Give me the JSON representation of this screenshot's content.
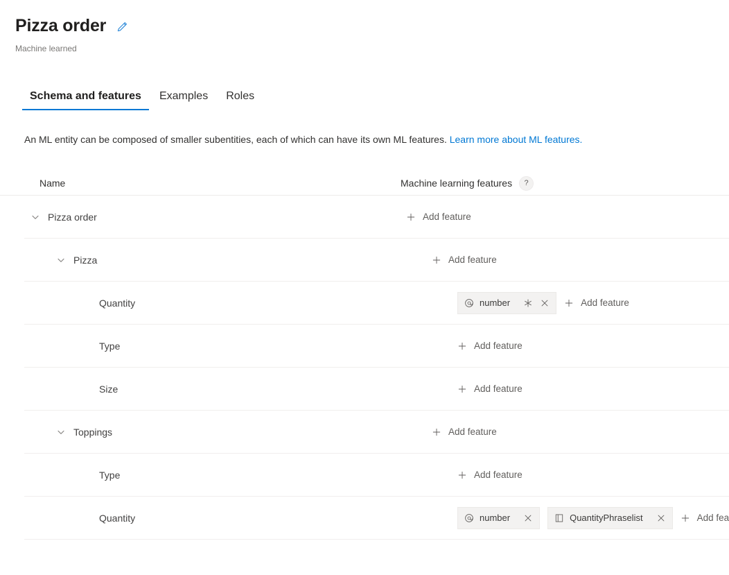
{
  "header": {
    "title": "Pizza order",
    "edit_icon": "pencil-icon",
    "subtitle": "Machine learned",
    "accent_color": "#0078d4"
  },
  "tabs": [
    {
      "label": "Schema and features",
      "active": true
    },
    {
      "label": "Examples",
      "active": false
    },
    {
      "label": "Roles",
      "active": false
    }
  ],
  "description": {
    "text": "An ML entity can be composed of smaller subentities, each of which can have its own ML features.",
    "link_text": "Learn more about ML features."
  },
  "table": {
    "columns": {
      "name": "Name",
      "features": "Machine learning features",
      "help_badge": "?"
    },
    "add_feature_label": "Add feature",
    "rows": [
      {
        "name": "Pizza order",
        "depth": 0,
        "expandable": true,
        "chevron": "chevron-down-icon",
        "chips": []
      },
      {
        "name": "Pizza",
        "depth": 1,
        "expandable": true,
        "chevron": "chevron-down-icon",
        "chips": []
      },
      {
        "name": "Quantity",
        "depth": 2,
        "expandable": false,
        "chips": [
          {
            "icon": "at-sign-icon",
            "label": "number",
            "required": true,
            "required_icon": "asterisk-icon",
            "close_icon": "close-icon"
          }
        ]
      },
      {
        "name": "Type",
        "depth": 2,
        "expandable": false,
        "chips": []
      },
      {
        "name": "Size",
        "depth": 2,
        "expandable": false,
        "chips": []
      },
      {
        "name": "Toppings",
        "depth": 1,
        "expandable": true,
        "chevron": "chevron-down-icon",
        "chips": []
      },
      {
        "name": "Type",
        "depth": 2,
        "expandable": false,
        "chips": []
      },
      {
        "name": "Quantity",
        "depth": 2,
        "expandable": false,
        "chips": [
          {
            "icon": "at-sign-icon",
            "label": "number",
            "required": false,
            "close_icon": "close-icon"
          },
          {
            "icon": "phraselist-book-icon",
            "label": "QuantityPhraselist",
            "required": false,
            "close_icon": "close-icon"
          }
        ]
      }
    ]
  }
}
